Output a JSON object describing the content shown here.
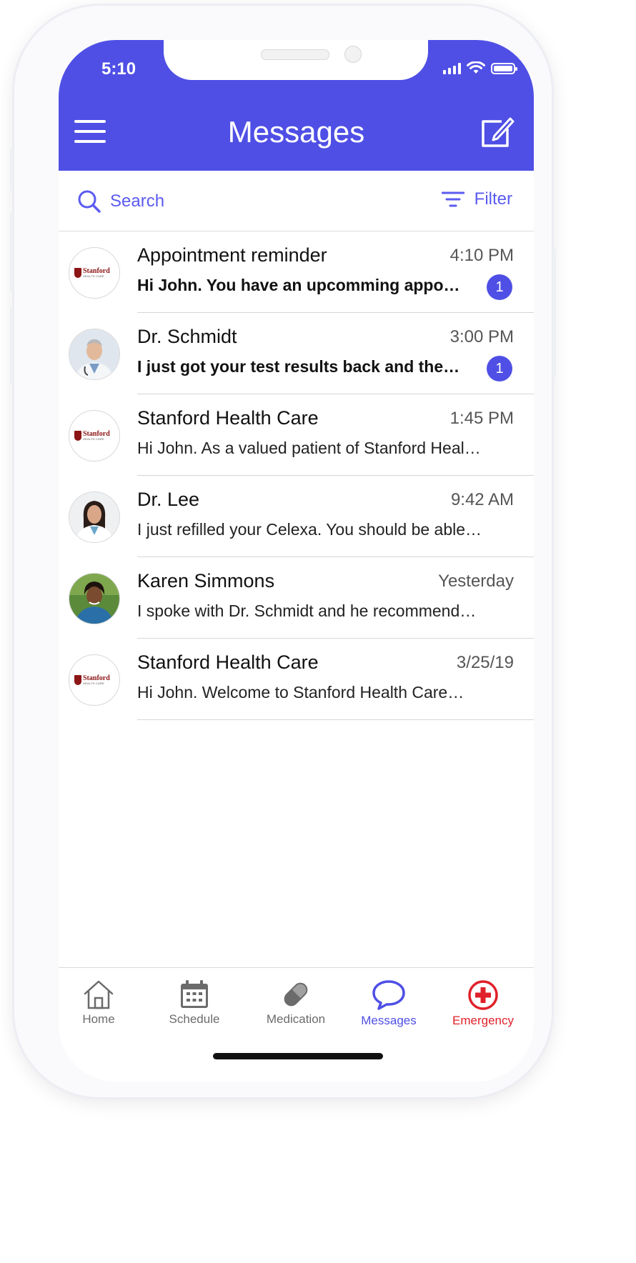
{
  "status_bar": {
    "time": "5:10"
  },
  "header": {
    "title": "Messages"
  },
  "toolbar": {
    "search_label": "Search",
    "filter_label": "Filter"
  },
  "messages": [
    {
      "sender": "Appointment reminder",
      "time": "4:10 PM",
      "preview": "Hi John. You have an upcomming appo…",
      "unread_count": "1",
      "avatar": "stanford-logo"
    },
    {
      "sender": "Dr. Schmidt",
      "time": "3:00 PM",
      "preview": "I just got your test results back and the…",
      "unread_count": "1",
      "avatar": "doctor-photo"
    },
    {
      "sender": "Stanford Health Care",
      "time": "1:45 PM",
      "preview": "Hi John. As a valued patient of Stanford Heal…",
      "avatar": "stanford-logo"
    },
    {
      "sender": "Dr. Lee",
      "time": "9:42 AM",
      "preview": "I just refilled your Celexa. You should be able…",
      "avatar": "doctor-photo"
    },
    {
      "sender": "Karen Simmons",
      "time": "Yesterday",
      "preview": "I spoke with Dr. Schmidt and he recommend…",
      "avatar": "nurse-photo"
    },
    {
      "sender": "Stanford Health Care",
      "time": "3/25/19",
      "preview": "Hi John. Welcome to Stanford Health Care…",
      "avatar": "stanford-logo"
    }
  ],
  "stanford_logo": {
    "name": "Stanford",
    "sub": "HEALTH CARE"
  },
  "tabs": [
    {
      "label": "Home",
      "icon": "home-icon"
    },
    {
      "label": "Schedule",
      "icon": "calendar-icon"
    },
    {
      "label": "Medication",
      "icon": "pill-icon"
    },
    {
      "label": "Messages",
      "icon": "chat-bubble-icon",
      "active": true
    },
    {
      "label": "Emergency",
      "icon": "emergency-cross-icon"
    }
  ],
  "colors": {
    "primary": "#4f4fe6",
    "emergency": "#e0202a",
    "brand_stanford": "#8c1515"
  }
}
